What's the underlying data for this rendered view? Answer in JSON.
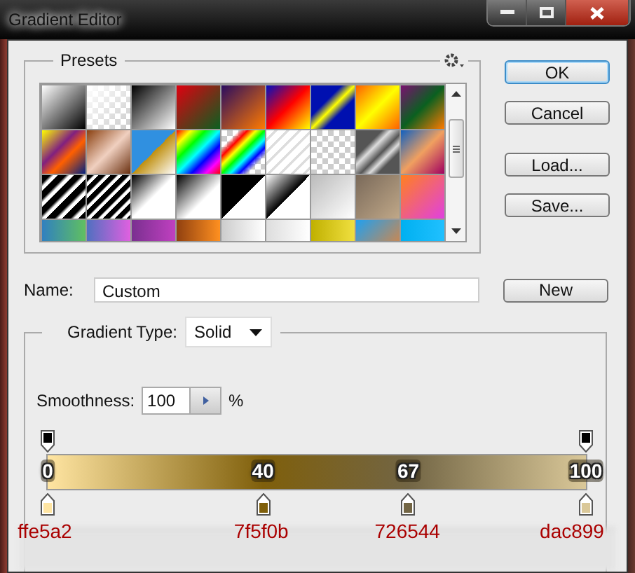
{
  "window": {
    "title": "Gradient Editor"
  },
  "presets": {
    "title": "Presets"
  },
  "buttons": [
    {
      "label": "OK",
      "default": true
    },
    {
      "label": "Cancel",
      "default": false
    },
    {
      "label": "Load..."
    },
    {
      "label": "Save..."
    }
  ],
  "name_field": {
    "label": "Name:",
    "value": "Custom"
  },
  "new_button": {
    "label": "New"
  },
  "gradient_type": {
    "label": "Gradient Type:",
    "value": "Solid"
  },
  "smoothness": {
    "label": "Smoothness:",
    "value": "100",
    "unit": "%"
  },
  "opacity_stops": [
    {
      "level": 0
    },
    {
      "level": 1
    }
  ],
  "color_stops": [
    {
      "location": "0",
      "level": 0,
      "color": "#ffe5a2",
      "hex": "ffe5a2"
    },
    {
      "location": "40",
      "level": 0.4,
      "color": "#7f5f0b",
      "hex": "7f5f0b"
    },
    {
      "location": "67",
      "level": 0.67,
      "color": "#726544",
      "hex": "726544"
    },
    {
      "location": "100",
      "level": 1,
      "color": "#dac899",
      "hex": "dac899"
    }
  ]
}
